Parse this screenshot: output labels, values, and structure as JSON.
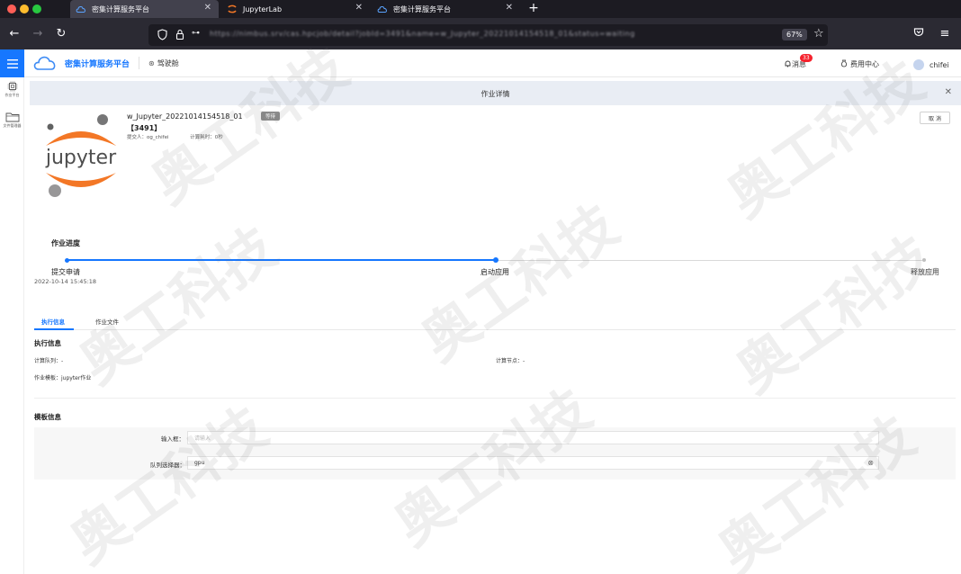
{
  "browser": {
    "tabs": [
      {
        "title": "密集计算服务平台",
        "active": true
      },
      {
        "title": "JupyterLab",
        "active": false
      },
      {
        "title": "密集计算服务平台",
        "active": false
      }
    ],
    "url": "https://nimbus.srv/cas.hpcjob/detail?jobId=3491&name=w_Jupyter_20221014154518_01&status=waiting",
    "zoom": "67%"
  },
  "header": {
    "app_name": "密集计算服务平台",
    "cockpit": "驾驶舱",
    "messages": "消息",
    "message_count": "33",
    "billing": "费用中心",
    "username": "chifei"
  },
  "sidebar": {
    "items": [
      {
        "label": "作业平台",
        "icon": "chip-icon"
      },
      {
        "label": "文件管理器",
        "icon": "folder-icon"
      }
    ]
  },
  "panel": {
    "title": "作业详情"
  },
  "job": {
    "name": "w_Jupyter_20221014154518_01",
    "id": "【3491】",
    "submitter": "提交人：og_chifei",
    "duration": "计算耗时：0秒",
    "status": "等待",
    "cancel_label": "取 消"
  },
  "progress": {
    "title": "作业进度",
    "steps": [
      {
        "label": "提交申请",
        "time": "2022-10-14 15:45:18"
      },
      {
        "label": "启动应用"
      },
      {
        "label": "释放应用"
      }
    ]
  },
  "tabs": {
    "items": [
      "执行信息",
      "作业文件"
    ]
  },
  "exec_info": {
    "title": "执行信息",
    "queue": "计算队列：-",
    "node": "计算节点：-",
    "template": "作业模板：jupyter作业"
  },
  "template_info": {
    "title": "模板信息",
    "input_label": "输入框：",
    "input_placeholder": "请输入",
    "queue_label": "队列选择器：",
    "queue_value": "gpu"
  },
  "watermark": "奥工科技",
  "colors": {
    "primary": "#1677ff",
    "panel_bg": "#e9edf4",
    "jupyter_orange": "#f37726"
  }
}
